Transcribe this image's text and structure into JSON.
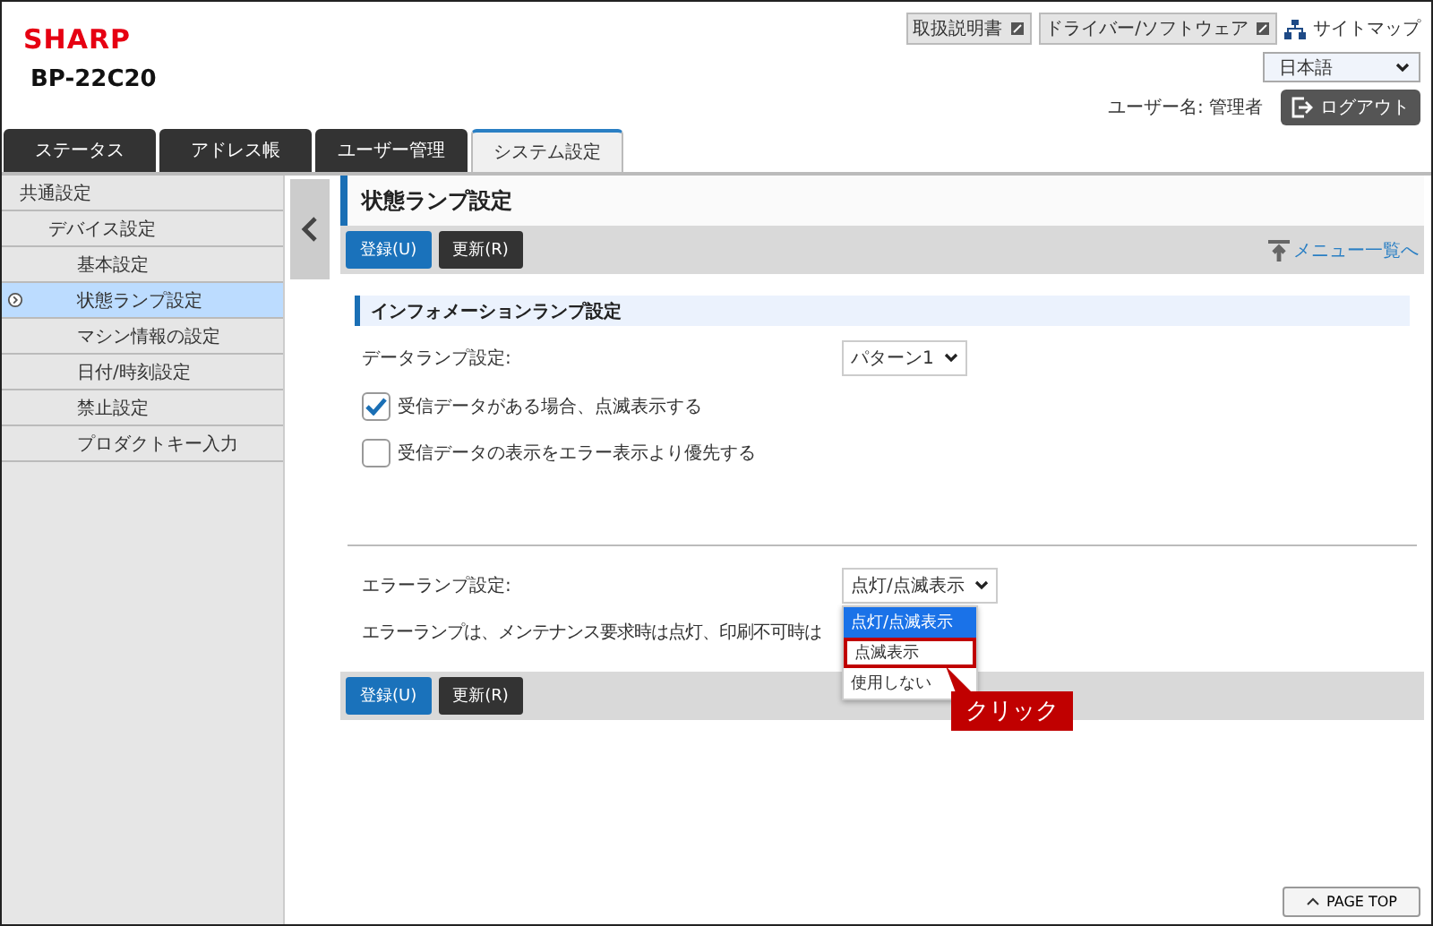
{
  "header": {
    "logo": "SHARP",
    "model": "BP-22C20",
    "links": [
      {
        "label": "取扱説明書"
      },
      {
        "label": "ドライバー/ソフトウェア"
      }
    ],
    "sitemap": "サイトマップ",
    "language": "日本語",
    "user": "ユーザー名: 管理者",
    "logout": "ログアウト"
  },
  "tabs": [
    {
      "label": "ステータス",
      "selected": false
    },
    {
      "label": "アドレス帳",
      "selected": false
    },
    {
      "label": "ユーザー管理",
      "selected": false
    },
    {
      "label": "システム設定",
      "selected": true
    }
  ],
  "sidebar": {
    "items": [
      {
        "label": "共通設定",
        "selected": false,
        "children": [
          {
            "label": "デバイス設定",
            "selected": false,
            "children": [
              {
                "label": "基本設定",
                "selected": false
              },
              {
                "label": "状態ランプ設定",
                "selected": true
              },
              {
                "label": "マシン情報の設定",
                "selected": false
              },
              {
                "label": "日付/時刻設定",
                "selected": false
              },
              {
                "label": "禁止設定",
                "selected": false
              },
              {
                "label": "プロダクトキー入力",
                "selected": false
              }
            ]
          }
        ]
      }
    ]
  },
  "page": {
    "title": "状態ランプ設定",
    "toolbar_buttons": [
      {
        "label": "登録(U)",
        "kind": "primary"
      },
      {
        "label": "更新(R)",
        "kind": "secondary"
      }
    ],
    "menu_link": "メニュー一覧へ",
    "section": "インフォメーションランプ設定",
    "data_lamp": {
      "label": "データランプ設定:",
      "value": "パターン1"
    },
    "checkboxes": [
      {
        "label": "受信データがある場合、点滅表示する",
        "checked": true
      },
      {
        "label": "受信データの表示をエラー表示より優先する",
        "checked": false
      }
    ],
    "error_lamp": {
      "label": "エラーランプ設定:",
      "value": "点灯/点滅表示",
      "description": "エラーランプは、メンテナンス要求時は点灯、印刷不可時は",
      "options": [
        {
          "label": "点灯/点滅表示",
          "selected": true,
          "highlighted": false
        },
        {
          "label": "点滅表示",
          "selected": false,
          "highlighted": true
        },
        {
          "label": "使用しない",
          "selected": false,
          "highlighted": false
        }
      ]
    },
    "bottom_buttons": [
      {
        "label": "登録(U)",
        "kind": "primary"
      },
      {
        "label": "更新(R)",
        "kind": "secondary"
      }
    ]
  },
  "callout": "クリック",
  "page_top": "PAGE TOP"
}
